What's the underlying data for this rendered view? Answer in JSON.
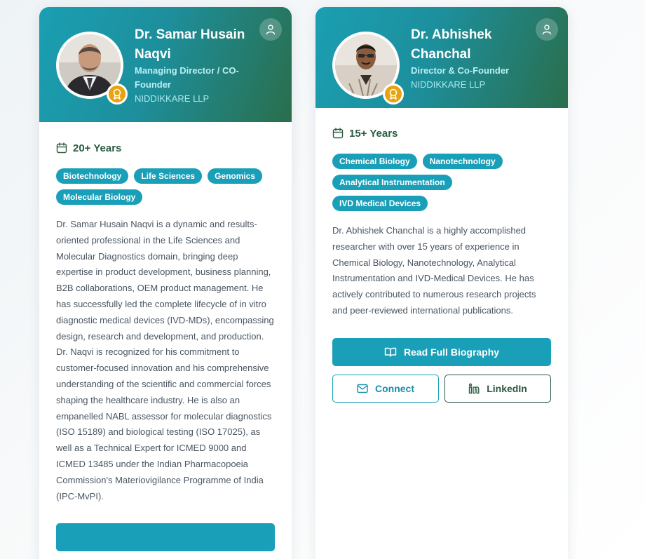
{
  "cards": [
    {
      "name": "Dr. Samar Husain Naqvi",
      "role": "Managing Director / CO-Founder",
      "company": "NIDDIKKARE LLP",
      "experience": "20+ Years",
      "tags": [
        "Biotechnology",
        "Life Sciences",
        "Genomics",
        "Molecular Biology"
      ],
      "bio": "Dr. Samar Husain Naqvi is a dynamic and results-oriented professional in the Life Sciences and Molecular Diagnostics domain, bringing deep expertise in product development, business planning, B2B collaborations, OEM product management. He has successfully led the complete lifecycle of in vitro diagnostic medical devices (IVD-MDs), encompassing design, research and development, and production. Dr. Naqvi is recognized for his commitment to customer-focused innovation and his comprehensive understanding of the scientific and commercial forces shaping the healthcare industry. He is also an empanelled NABL assessor for molecular diagnostics (ISO 15189) and biological testing (ISO 17025), as well as a Technical Expert for ICMED 9000 and ICMED 13485 under the Indian Pharmacopoeia Commission's Materiovigilance Programme of India (IPC-MvPI)."
    },
    {
      "name": "Dr. Abhishek Chanchal",
      "role": "Director & Co-Founder",
      "company": "NIDDIKKARE LLP",
      "experience": "15+ Years",
      "tags": [
        "Chemical Biology",
        "Nanotechnology",
        "Analytical Instrumentation",
        "IVD Medical Devices"
      ],
      "bio": "Dr. Abhishek Chanchal is a highly accomplished researcher with over 15 years of experience in Chemical Biology, Nanotechnology, Analytical Instrumentation and IVD-Medical Devices. He has actively contributed to numerous research projects and peer-reviewed international publications.",
      "read_bio_label": "Read Full Biography",
      "connect_label": "Connect",
      "linkedin_label": "LinkedIn"
    }
  ],
  "icons": {
    "user": "user-icon",
    "award": "award-icon",
    "calendar": "calendar-icon",
    "book": "book-open-icon",
    "mail": "mail-icon",
    "linkedin": "linkedin-icon"
  },
  "colors": {
    "accent": "#1a9fb8",
    "dark_green": "#2b5a40",
    "award_gold": "#e7a310"
  }
}
